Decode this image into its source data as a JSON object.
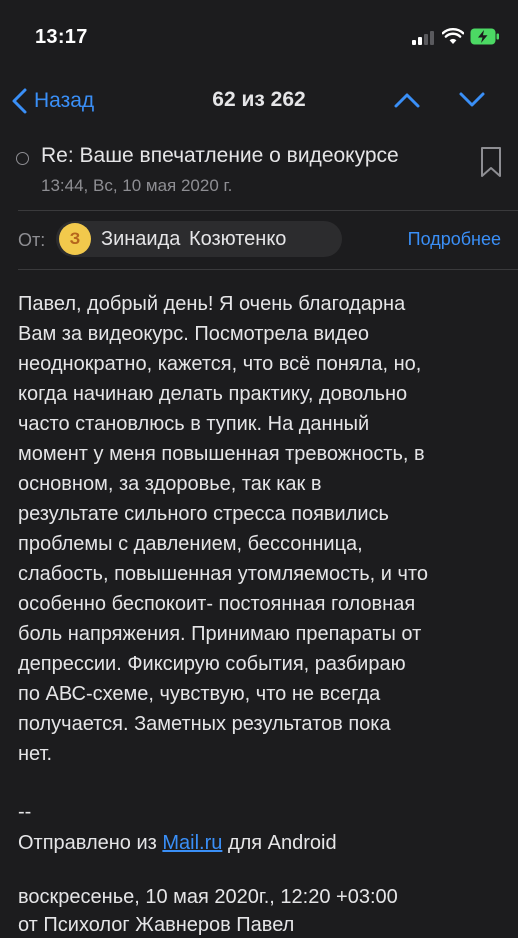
{
  "status_bar": {
    "time": "13:17"
  },
  "nav": {
    "back_label": "Назад",
    "counter": "62 из 262"
  },
  "message": {
    "subject": "Re: Ваше впечатление о видеокурсе",
    "date": "13:44, Вс, 10 мая 2020 г.",
    "from_label": "От:",
    "sender_initial": "З",
    "sender_name": "Зинаида Козютенко",
    "details_label": "Подробнее",
    "body_lines": [
      "Павел, добрый день! Я очень благодарна",
      "Вам за видеокурс. Посмотрела видео",
      "неоднократно, кажется, что всё поняла, но,",
      "когда начинаю делать практику, довольно",
      "часто становлюсь в тупик. На данный",
      "момент у меня повышенная тревожность, в",
      "основном, за здоровье, так как в",
      "результате сильного стресса появились",
      "проблемы с давлением, бессонница,",
      "слабость, повышенная утомляемость, и что",
      "особенно беспокоит- постоянная головная",
      "боль напряжения. Принимаю препараты от",
      "депрессии. Фиксирую события, разбираю",
      "по АВС-схеме, чувствую, что не всегда",
      "получается. Заметных результатов пока",
      "нет."
    ],
    "signature_separator": "--",
    "signature_prefix": "Отправлено из ",
    "signature_link": "Mail.ru",
    "signature_suffix": " для Android",
    "quote_header": "воскресенье, 10 мая 2020г., 12:20 +03:00",
    "quote_from": "от Психолог Жавнеров Павел"
  },
  "colors": {
    "background": "#1c1c1e",
    "accent": "#3a8ff7",
    "avatar": "#f2c94c",
    "battery": "#4cd964"
  }
}
